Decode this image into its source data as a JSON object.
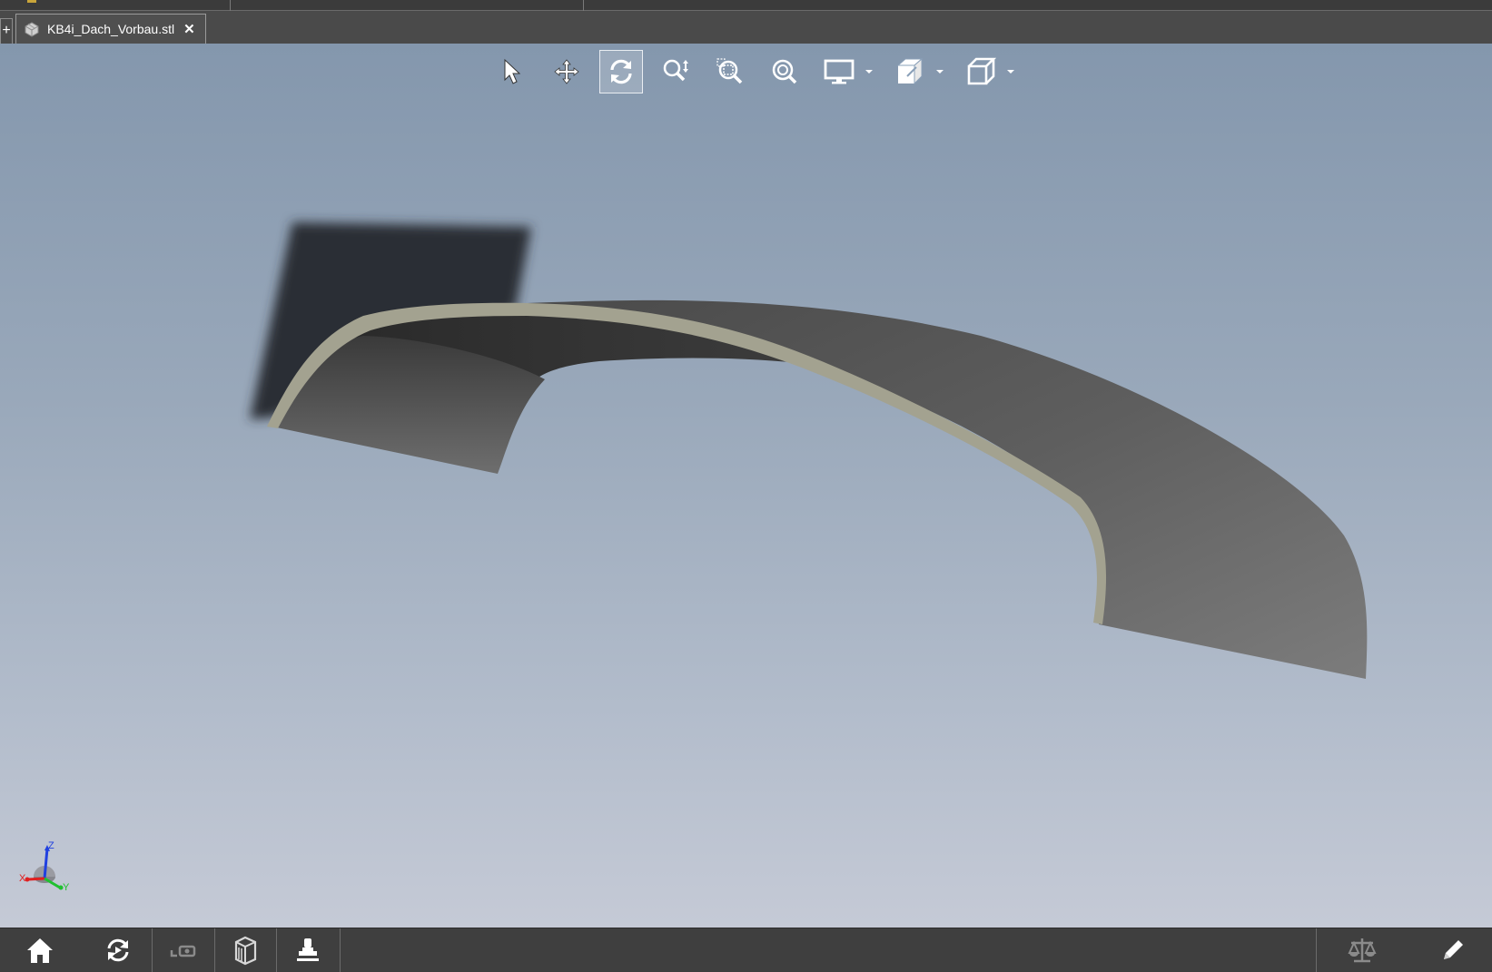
{
  "window": {
    "new_tab_symbol": "+",
    "document_tab": {
      "label": "KB4i_Dach_Vorbau.stl",
      "close_symbol": "✕",
      "icon": "stl-file-icon"
    }
  },
  "view_toolbar": {
    "tools": [
      {
        "id": "select",
        "icon": "cursor-arrow-icon",
        "active": false
      },
      {
        "id": "pan",
        "icon": "move-arrows-icon",
        "active": false
      },
      {
        "id": "rotate",
        "icon": "rotate-icon",
        "active": true
      },
      {
        "id": "zoom",
        "icon": "zoom-updown-icon",
        "active": false
      },
      {
        "id": "zoom-window",
        "icon": "zoom-window-icon",
        "active": false
      },
      {
        "id": "zoom-fit",
        "icon": "zoom-fit-icon",
        "active": false
      },
      {
        "id": "display-mode",
        "icon": "monitor-icon",
        "has_dropdown": true
      },
      {
        "id": "section-view",
        "icon": "section-cube-icon",
        "has_dropdown": true
      },
      {
        "id": "view-cube",
        "icon": "cube-outline-icon",
        "has_dropdown": true
      }
    ]
  },
  "model": {
    "name": "KB4i_Dach_Vorbau.stl",
    "surface_color": "#5b5b5b",
    "edge_color": "#a3a290"
  },
  "axis_triad": {
    "x_label": "X",
    "y_label": "Y",
    "z_label": "Z",
    "x_color": "#e02020",
    "y_color": "#20c030",
    "z_color": "#2040e0"
  },
  "bottom_bar": {
    "left": [
      "home-icon",
      "refresh-icon",
      "3d-print-icon",
      "buildplate-icon",
      "stamp-icon"
    ],
    "right": [
      "scale-balance-icon",
      "pencil-icon"
    ]
  },
  "colors": {
    "bg_top": "#8497ad",
    "bg_bottom": "#c5cad6",
    "chrome": "#3f3f3f"
  }
}
